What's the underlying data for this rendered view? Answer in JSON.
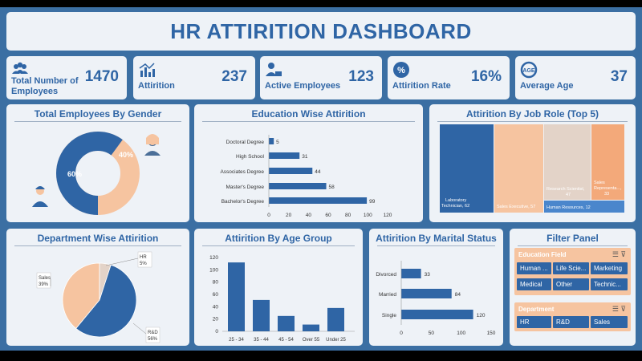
{
  "title": "HR ATTIRITION DASHBOARD",
  "kpis": [
    {
      "label": "Total Number of Employees",
      "value": "1470",
      "icon": "people-icon"
    },
    {
      "label": "Attirition",
      "value": "237",
      "icon": "bar-chart-icon"
    },
    {
      "label": "Active Employees",
      "value": "123",
      "icon": "employee-icon"
    },
    {
      "label": "Attirition Rate",
      "value": "16%",
      "icon": "percent-icon"
    },
    {
      "label": "Average Age",
      "value": "37",
      "icon": "age-icon"
    }
  ],
  "gender": {
    "title": "Total Employees By Gender",
    "male_label": "60%",
    "female_label": "40%",
    "colors": {
      "male": "#2f65a5",
      "female": "#f6c4a0"
    }
  },
  "education": {
    "title": "Education Wise Attirition",
    "ticks": [
      "0",
      "20",
      "40",
      "60",
      "80",
      "100",
      "120"
    ]
  },
  "jobrole": {
    "title": "Attirition By Job Role (Top 5)",
    "tiles": [
      {
        "label": "Laboratory Technician, 62",
        "value": 62,
        "color": "#2f65a5"
      },
      {
        "label": "Sales Executive, 57",
        "value": 57,
        "color": "#f6c4a0"
      },
      {
        "label": "Research Scientist, 47",
        "value": 47,
        "color": "#e3d3c8"
      },
      {
        "label": "Sales Representa..., 33",
        "value": 33,
        "color": "#f3a97a"
      },
      {
        "label": "Human Resources, 12",
        "value": 12,
        "color": "#4a86cc"
      }
    ]
  },
  "department": {
    "title": "Department Wise Attirition",
    "slices": [
      {
        "name": "Sales",
        "pct": "39%"
      },
      {
        "name": "HR",
        "pct": "5%"
      },
      {
        "name": "R&D",
        "pct": "56%"
      }
    ]
  },
  "agegroup": {
    "title": "Attirition By Age Group",
    "ticks": [
      "0",
      "20",
      "40",
      "60",
      "80",
      "100",
      "120"
    ]
  },
  "marital": {
    "title": "Attirition By Marital Status",
    "ticks": [
      "0",
      "50",
      "100",
      "150"
    ]
  },
  "filter": {
    "title": "Filter Panel",
    "education_field": {
      "heading": "Education Field",
      "items": [
        "Human ...",
        "Life Scie...",
        "Marketing",
        "Medical",
        "Other",
        "Technic..."
      ]
    },
    "department": {
      "heading": "Department",
      "items": [
        "HR",
        "R&D",
        "Sales"
      ]
    }
  },
  "chart_data": [
    {
      "type": "pie",
      "title": "Total Employees By Gender",
      "categories": [
        "Male",
        "Female"
      ],
      "values": [
        60,
        40
      ]
    },
    {
      "type": "bar",
      "title": "Education Wise Attirition",
      "categories": [
        "Doctoral Degree",
        "High School",
        "Associates Degree",
        "Master's Degree",
        "Bachelor's Degree"
      ],
      "values": [
        5,
        31,
        44,
        58,
        99
      ],
      "xlim": [
        0,
        120
      ]
    },
    {
      "type": "pie",
      "title": "Department Wise Attirition",
      "categories": [
        "Sales",
        "HR",
        "R&D"
      ],
      "values": [
        39,
        5,
        56
      ]
    },
    {
      "type": "bar",
      "title": "Attirition By Age Group",
      "categories": [
        "25 - 34",
        "35 - 44",
        "45 - 54",
        "Over 55",
        "Under 25"
      ],
      "values": [
        112,
        51,
        25,
        11,
        38
      ],
      "ylim": [
        0,
        120
      ]
    },
    {
      "type": "bar",
      "title": "Attirition By Marital Status",
      "categories": [
        "Divorced",
        "Married",
        "Single"
      ],
      "values": [
        33,
        84,
        120
      ],
      "xlim": [
        0,
        150
      ]
    }
  ]
}
